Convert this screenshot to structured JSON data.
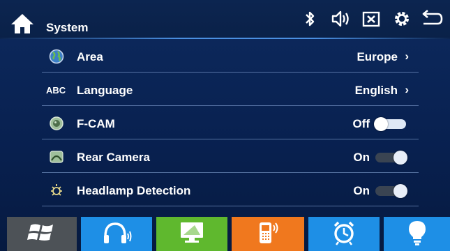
{
  "header": {
    "title": "System",
    "icons": [
      "home-icon",
      "bluetooth-icon",
      "volume-icon",
      "close-icon",
      "settings-icon",
      "back-icon"
    ]
  },
  "settings": [
    {
      "label": "Area",
      "value": "Europe",
      "type": "link",
      "icon": "globe-icon"
    },
    {
      "label": "Language",
      "value": "English",
      "type": "link",
      "icon": "abc-icon",
      "icon_text": "ABC"
    },
    {
      "label": "F-CAM",
      "value": "Off",
      "type": "toggle",
      "on": false,
      "icon": "camera-lens-icon"
    },
    {
      "label": "Rear Camera",
      "value": "On",
      "type": "toggle",
      "on": true,
      "icon": "rear-camera-icon"
    },
    {
      "label": "Headlamp Detection",
      "value": "On",
      "type": "toggle",
      "on": true,
      "icon": "headlamp-icon"
    }
  ],
  "dock": [
    {
      "icon": "windows-icon",
      "color": "#4d5257"
    },
    {
      "icon": "headphones-icon",
      "color": "#1e8fe6"
    },
    {
      "icon": "monitor-icon",
      "color": "#5fb82e"
    },
    {
      "icon": "phone-icon",
      "color": "#f0781e"
    },
    {
      "icon": "alarm-clock-icon",
      "color": "#1e8fe6"
    },
    {
      "icon": "lightbulb-icon",
      "color": "#1e8fe6"
    }
  ],
  "colors": {
    "background": "#0d2a5e",
    "accent": "#4a8fe0"
  }
}
